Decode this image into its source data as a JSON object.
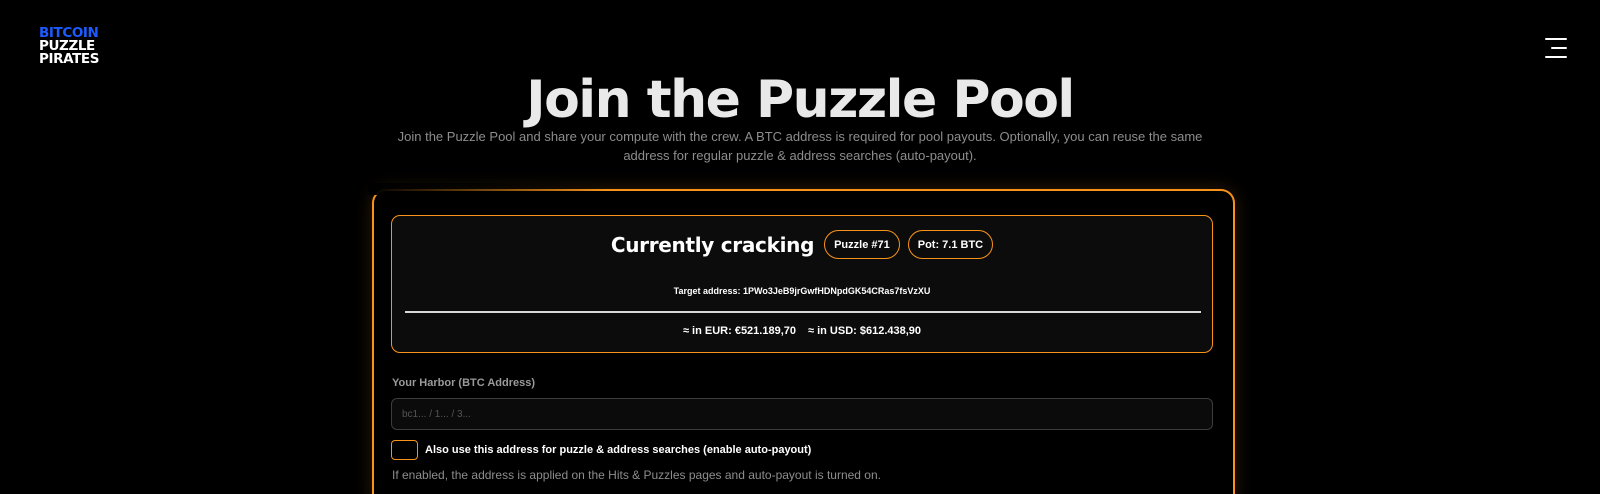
{
  "brand": {
    "line1": "BITCOIN",
    "line2": "PUZZLE",
    "line3": "PIRATES",
    "accent_color": "#1d5bff"
  },
  "nav": {
    "menu_icon": "hamburger-menu-icon"
  },
  "hero": {
    "title": "Join the Puzzle Pool",
    "subtitle": "Join the Puzzle Pool and share your compute with the crew. A BTC address is required for pool payouts. Optionally, you can reuse the same address for regular puzzle & address searches (auto-payout)."
  },
  "cracking": {
    "title": "Currently cracking",
    "puzzle_badge": "Puzzle #71",
    "pot_badge": "Pot: 7.1 BTC",
    "target_address": "Target address: 1PWo3JeB9jrGwfHDNpdGK54CRas7fsVzXU",
    "eur_value": "≈ in EUR: €521.189,70",
    "usd_value": "≈ in USD: $612.438,90"
  },
  "form": {
    "address_label": "Your Harbor (BTC Address)",
    "address_placeholder": "bc1... / 1... / 3...",
    "address_value": "",
    "checkbox_label": "Also use this address for puzzle & address searches (enable auto-payout)",
    "checkbox_checked": false,
    "hint": "If enabled, the address is applied on the Hits & Puzzles pages and auto-payout is turned on."
  },
  "colors": {
    "accent": "#f7931a",
    "background": "#000000"
  }
}
